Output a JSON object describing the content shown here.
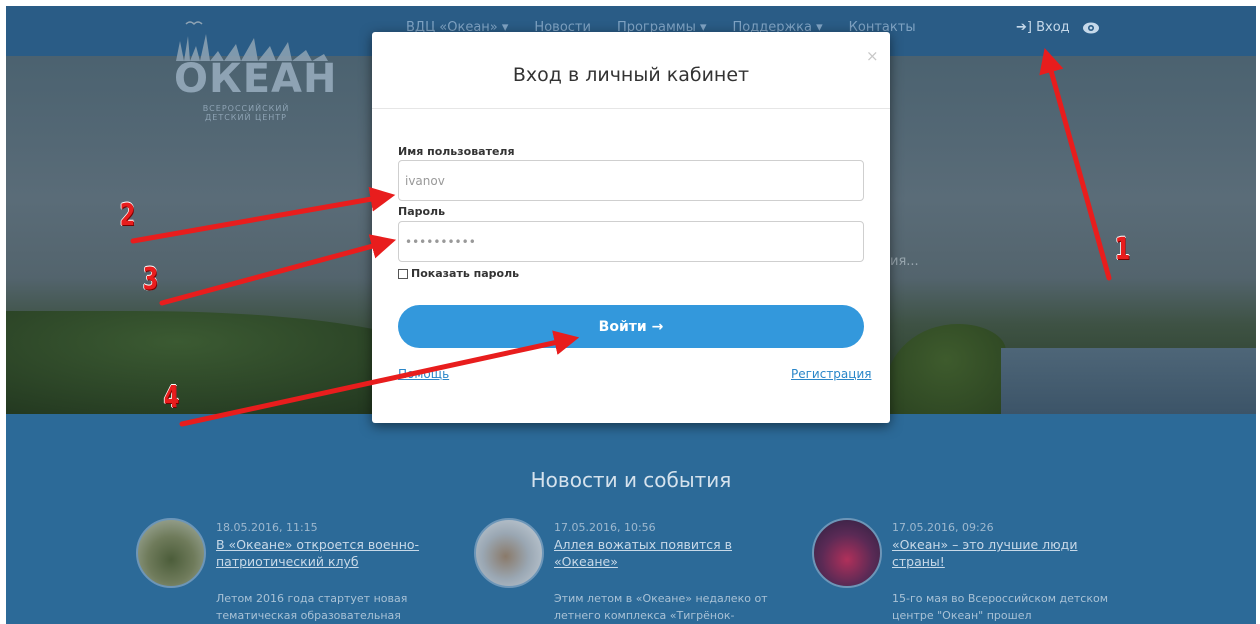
{
  "nav": {
    "items": [
      "ВДЦ «Океан» ▾",
      "Новости",
      "Программы ▾",
      "Поддержка ▾",
      "Контакты"
    ],
    "login": "Вход"
  },
  "logo": {
    "word": "ОКЕАН",
    "sub": "ВСЕРОССИЙСКИЙ ДЕТСКИЙ ЦЕНТР"
  },
  "hero": {
    "text": "ия..."
  },
  "modal": {
    "title": "Вход в личный кабинет",
    "close": "×",
    "username_label": "Имя пользователя",
    "username_value": "ivanov",
    "password_label": "Пароль",
    "password_value": "••••••••••",
    "show_password": "Показать пароль",
    "submit": "Войти →",
    "help": "Помощь",
    "register": "Регистрация"
  },
  "news": {
    "title": "Новости и события",
    "items": [
      {
        "date": "18.05.2016, 11:15",
        "headline": "В «Океане» откроется военно-патриотический клуб",
        "text": "Летом 2016 года стартует новая тематическая образовательная"
      },
      {
        "date": "17.05.2016, 10:56",
        "headline": "Аллея вожатых появится в «Океане»",
        "text": "Этим летом в «Океане» недалеко от летнего комплекса «Тигрёнок-"
      },
      {
        "date": "17.05.2016, 09:26",
        "headline": "«Океан» – это лучшие люди страны!",
        "text": "15-го мая во Всероссийском детском центре \"Океан\" прошел"
      }
    ]
  },
  "annotations": [
    "1",
    "2",
    "3",
    "4"
  ],
  "colors": {
    "accent": "#3398dc",
    "arrow": "#e81d1d",
    "nav_bg": "#2a5c86",
    "news_bg": "#2c6a98"
  },
  "icons": [
    "login-icon",
    "eye-icon",
    "close-icon",
    "checkbox-icon"
  ]
}
